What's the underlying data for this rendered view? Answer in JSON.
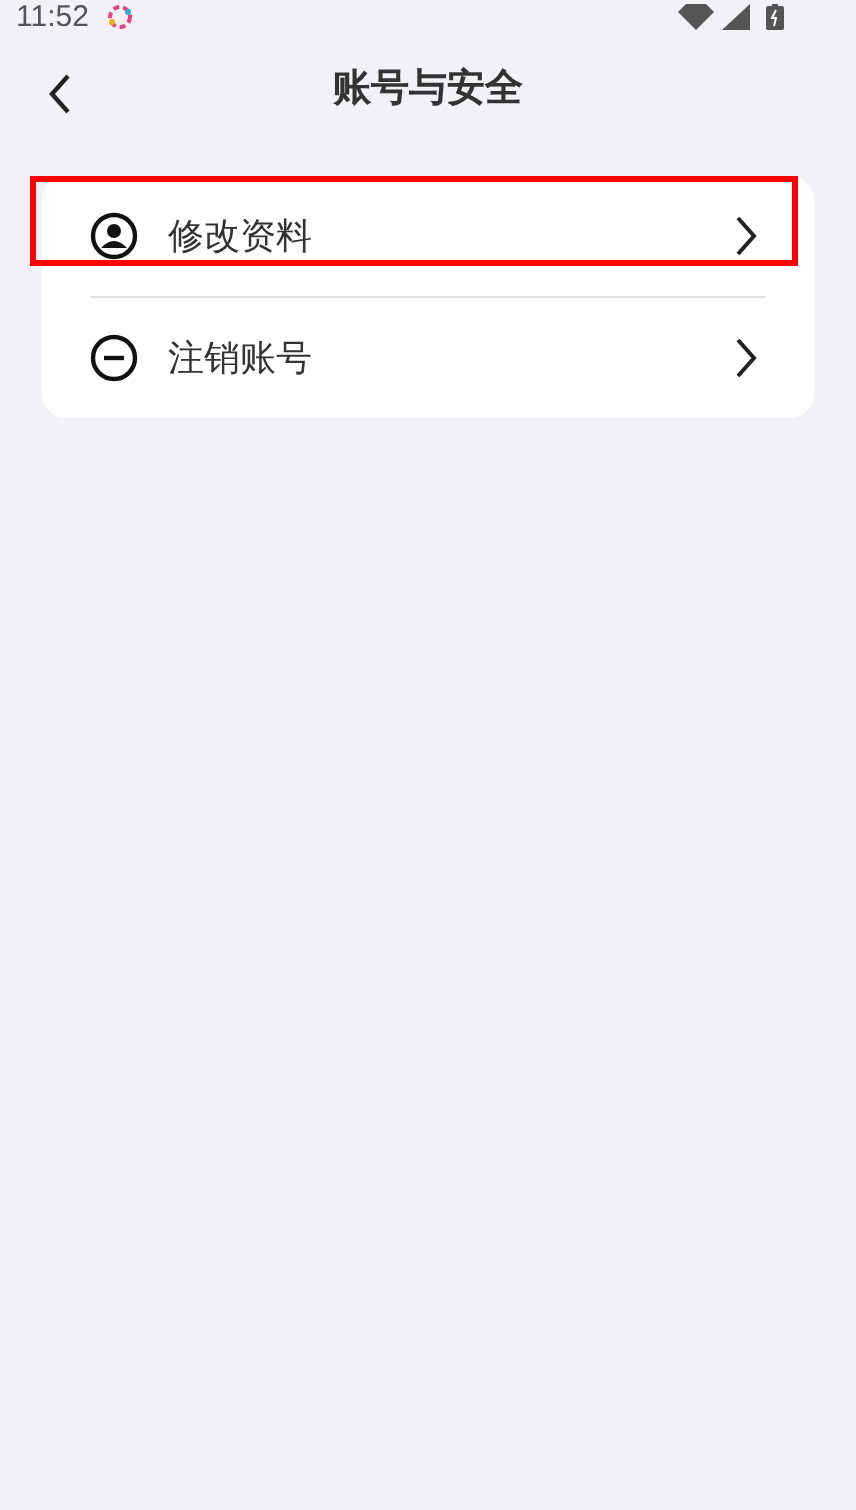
{
  "status_bar": {
    "time": "11:52"
  },
  "header": {
    "title": "账号与安全"
  },
  "menu": {
    "items": [
      {
        "kind": "profile",
        "label": "修改资料",
        "highlighted": true
      },
      {
        "kind": "cancel",
        "label": "注销账号",
        "highlighted": false
      }
    ]
  }
}
